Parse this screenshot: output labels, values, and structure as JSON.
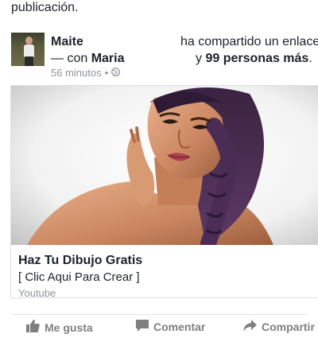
{
  "previous_post": {
    "text_tail": "publicación."
  },
  "post": {
    "author": "Maite",
    "action_text": "ha compartido un enlace",
    "with_prefix": "— con",
    "tagged": "Maria",
    "and_text": "y",
    "others": "99 personas más",
    "period": ".",
    "time": "56 minutos",
    "dot": "•",
    "privacy_icon": "globe-icon"
  },
  "link_card": {
    "title": "Haz Tu Dibujo Gratis",
    "description": "[ Clic Aqui Para Crear ]",
    "source": "Youtube"
  },
  "actions": {
    "like": "Me gusta",
    "comment": "Comentar",
    "share": "Compartir"
  },
  "colors": {
    "text": "#1d2129",
    "meta": "#90949c",
    "action": "#7f7f7f"
  }
}
